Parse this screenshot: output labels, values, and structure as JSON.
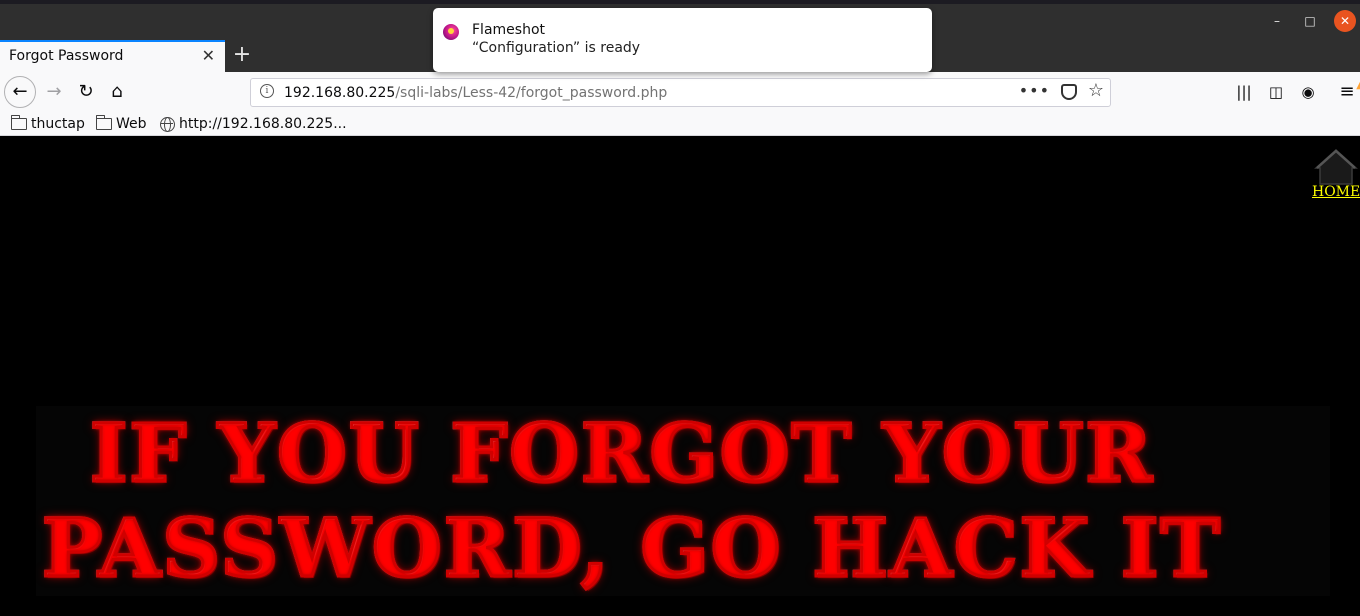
{
  "browser": {
    "tab": {
      "title": "Forgot Password",
      "close_icon": "close-icon"
    },
    "new_tab_label": "+",
    "window_controls": {
      "minimize": "–",
      "maximize": "□",
      "close": "✕"
    },
    "url": {
      "host": "192.168.80.225",
      "path": "/sqli-labs/Less-42/forgot_password.php"
    },
    "bookmarks": [
      {
        "label": "thuctap",
        "icon": "folder-icon"
      },
      {
        "label": "Web",
        "icon": "folder-icon"
      },
      {
        "label": "http://192.168.80.225...",
        "icon": "globe-icon"
      }
    ]
  },
  "notification": {
    "app": "Flameshot",
    "message": "“Configuration” is ready"
  },
  "page": {
    "home_label": "HOME",
    "banner_line1": "IF YOU FORGOT YOUR",
    "banner_line2": "PASSWORD, GO HACK IT"
  },
  "colors": {
    "page_background": "#000000",
    "home_link": "#ffff00",
    "banner_outline": "#d00000",
    "close_button": "#e95420",
    "tab_accent": "#0a84ff"
  }
}
